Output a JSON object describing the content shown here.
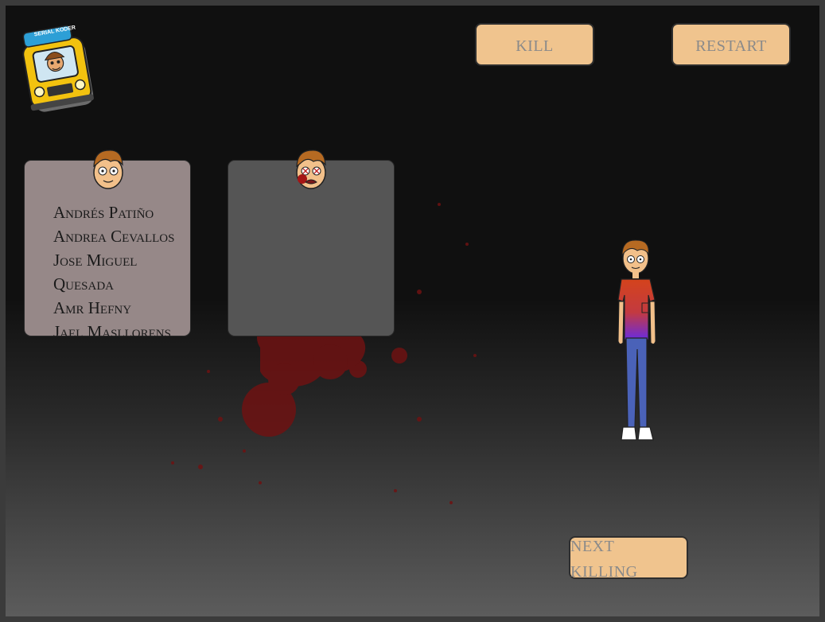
{
  "buttons": {
    "kill": "kill",
    "restart": "restart",
    "next_killing": "next killing"
  },
  "logo": {
    "text": "SERIAL KODER",
    "icon": "school-bus-logo"
  },
  "survivors_card": {
    "names": [
      "Andrés Patiño",
      "Andrea Cevallos",
      "Jose Miguel Quesada",
      "Amr Hefny",
      "Jael Masllorens"
    ]
  },
  "killed_card": {
    "names": []
  },
  "colors": {
    "button_bg": "#f0c48e",
    "button_text": "#8a8a8a",
    "alive_card": "#968888",
    "dead_card": "#555555",
    "blood": "#7a1414"
  }
}
